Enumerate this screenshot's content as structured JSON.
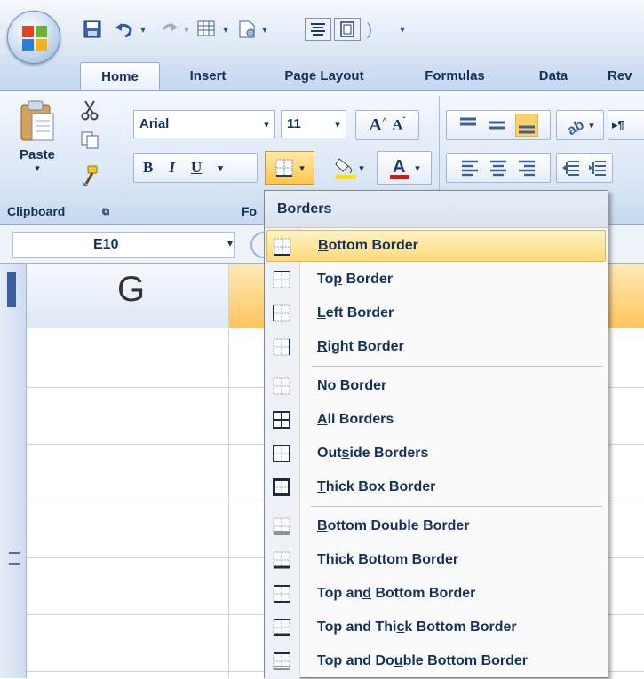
{
  "quick_access": {
    "undo_arrow": "▾",
    "customize_arrow": "▾"
  },
  "tabs": [
    {
      "label": "Home",
      "active": true
    },
    {
      "label": "Insert",
      "active": false
    },
    {
      "label": "Page Layout",
      "active": false
    },
    {
      "label": "Formulas",
      "active": false
    },
    {
      "label": "Data",
      "active": false
    },
    {
      "label": "Rev",
      "active": false
    }
  ],
  "ribbon": {
    "clipboard": {
      "paste_label": "Paste",
      "group_label": "Clipboard"
    },
    "font": {
      "font_name": "Arial",
      "font_size": "11",
      "bold": "B",
      "italic": "I",
      "underline": "U",
      "group_label_partial": "Fo"
    }
  },
  "formula_bar": {
    "name_box": "E10"
  },
  "grid": {
    "column_header": "G"
  },
  "borders_menu": {
    "header": "Borders",
    "items": [
      {
        "pre": "",
        "key": "B",
        "post": "ottom Border",
        "icon": "bottom-border-icon",
        "highlighted": true
      },
      {
        "pre": "To",
        "key": "p",
        "post": " Border",
        "icon": "top-border-icon",
        "highlighted": false
      },
      {
        "pre": "",
        "key": "L",
        "post": "eft Border",
        "icon": "left-border-icon",
        "highlighted": false
      },
      {
        "pre": "",
        "key": "R",
        "post": "ight Border",
        "icon": "right-border-icon",
        "highlighted": false
      },
      {
        "pre": "",
        "key": "N",
        "post": "o Border",
        "icon": "no-border-icon",
        "highlighted": false
      },
      {
        "pre": "",
        "key": "A",
        "post": "ll Borders",
        "icon": "all-borders-icon",
        "highlighted": false
      },
      {
        "pre": "Out",
        "key": "s",
        "post": "ide Borders",
        "icon": "outside-borders-icon",
        "highlighted": false
      },
      {
        "pre": "",
        "key": "T",
        "post": "hick Box Border",
        "icon": "thick-box-border-icon",
        "highlighted": false
      },
      {
        "pre": "",
        "key": "B",
        "post": "ottom Double Border",
        "icon": "bottom-double-border-icon",
        "highlighted": false
      },
      {
        "pre": "T",
        "key": "h",
        "post": "ick Bottom Border",
        "icon": "thick-bottom-border-icon",
        "highlighted": false
      },
      {
        "pre": "Top an",
        "key": "d",
        "post": " Bottom Border",
        "icon": "top-and-bottom-border-icon",
        "highlighted": false
      },
      {
        "pre": "Top and Thi",
        "key": "c",
        "post": "k Bottom Border",
        "icon": "top-and-thick-bottom-border-icon",
        "highlighted": false
      },
      {
        "pre": "Top and Do",
        "key": "u",
        "post": "ble Bottom Border",
        "icon": "top-and-double-bottom-border-icon",
        "highlighted": false
      }
    ]
  },
  "colors": {
    "ribbon_blue": "#c5d8f0",
    "highlight": "#ffd978",
    "text_dark_blue": "#15315a",
    "font_color_bar": "#d21b1b",
    "fill_color_bar": "#ffe000"
  }
}
